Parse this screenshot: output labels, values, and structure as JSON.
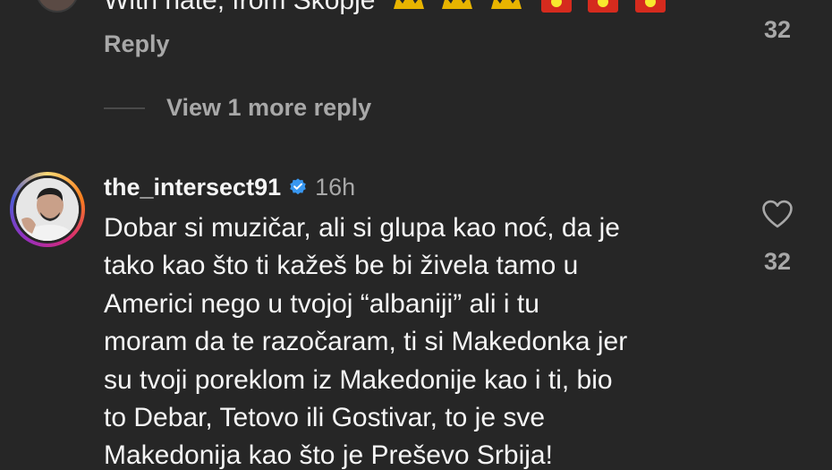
{
  "previous_comment": {
    "text": "With hate, from Skopje",
    "reply_label": "Reply",
    "like_count": "32"
  },
  "view_more": {
    "label": "View 1 more reply"
  },
  "comment": {
    "username": "the_intersect91",
    "time": "16h",
    "like_count": "32",
    "lines": [
      "Dobar si muzičar, ali si glupa kao noć, da je",
      "tako kao što ti kažeš be bi živela tamo u",
      "Americi nego u tvojoj “albaniji” ali i tu",
      "moram da te razočaram, ti si Makedonka jer",
      "su tvoji poreklom iz Makedonije kao i ti, bio",
      "to Debar, Tetovo ili Gostivar, to je sve",
      "Makedonija kao što je Preševo Srbija!"
    ]
  },
  "icons": {
    "heart": "heart-icon",
    "verified": "verified-badge-icon"
  },
  "colors": {
    "background": "#262626",
    "primary_text": "#f5f5f5",
    "secondary_text": "#a8a8a8",
    "verified_blue": "#3897f0"
  }
}
